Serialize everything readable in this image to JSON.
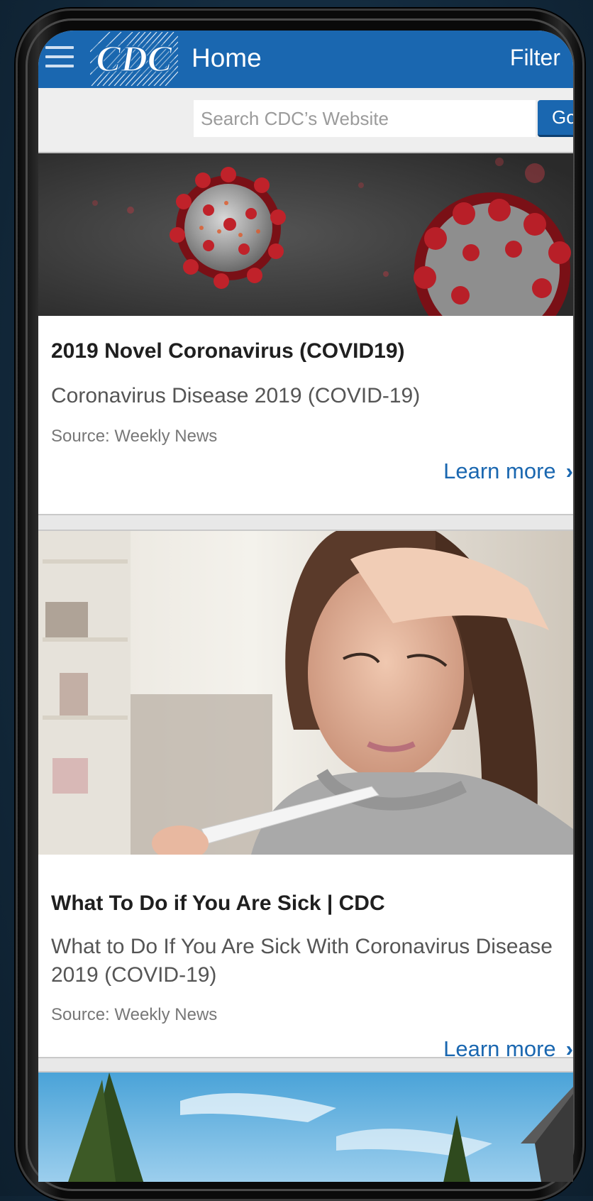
{
  "app": {
    "title": "Home",
    "logo_text": "CDC",
    "filter_label": "Filter"
  },
  "search": {
    "placeholder": "Search CDC’s Website",
    "button_label": "Go"
  },
  "cards": [
    {
      "title": "2019 Novel Coronavirus (COVID19)",
      "description": "Coronavirus Disease 2019 (COVID-19)",
      "source": "Source: Weekly News",
      "link_label": "Learn more"
    },
    {
      "title": "What To Do if You Are Sick | CDC",
      "description": "What to Do If You Are Sick With Coronavirus Disease 2019 (COVID-19)",
      "source": "Source: Weekly News",
      "link_label": "Learn more"
    }
  ],
  "icons": {
    "menu": "hamburger-menu-icon",
    "link_arrow": "chevron-right-icon"
  },
  "colors": {
    "brand_blue": "#1a67b0",
    "background": "#e8e8e8"
  }
}
